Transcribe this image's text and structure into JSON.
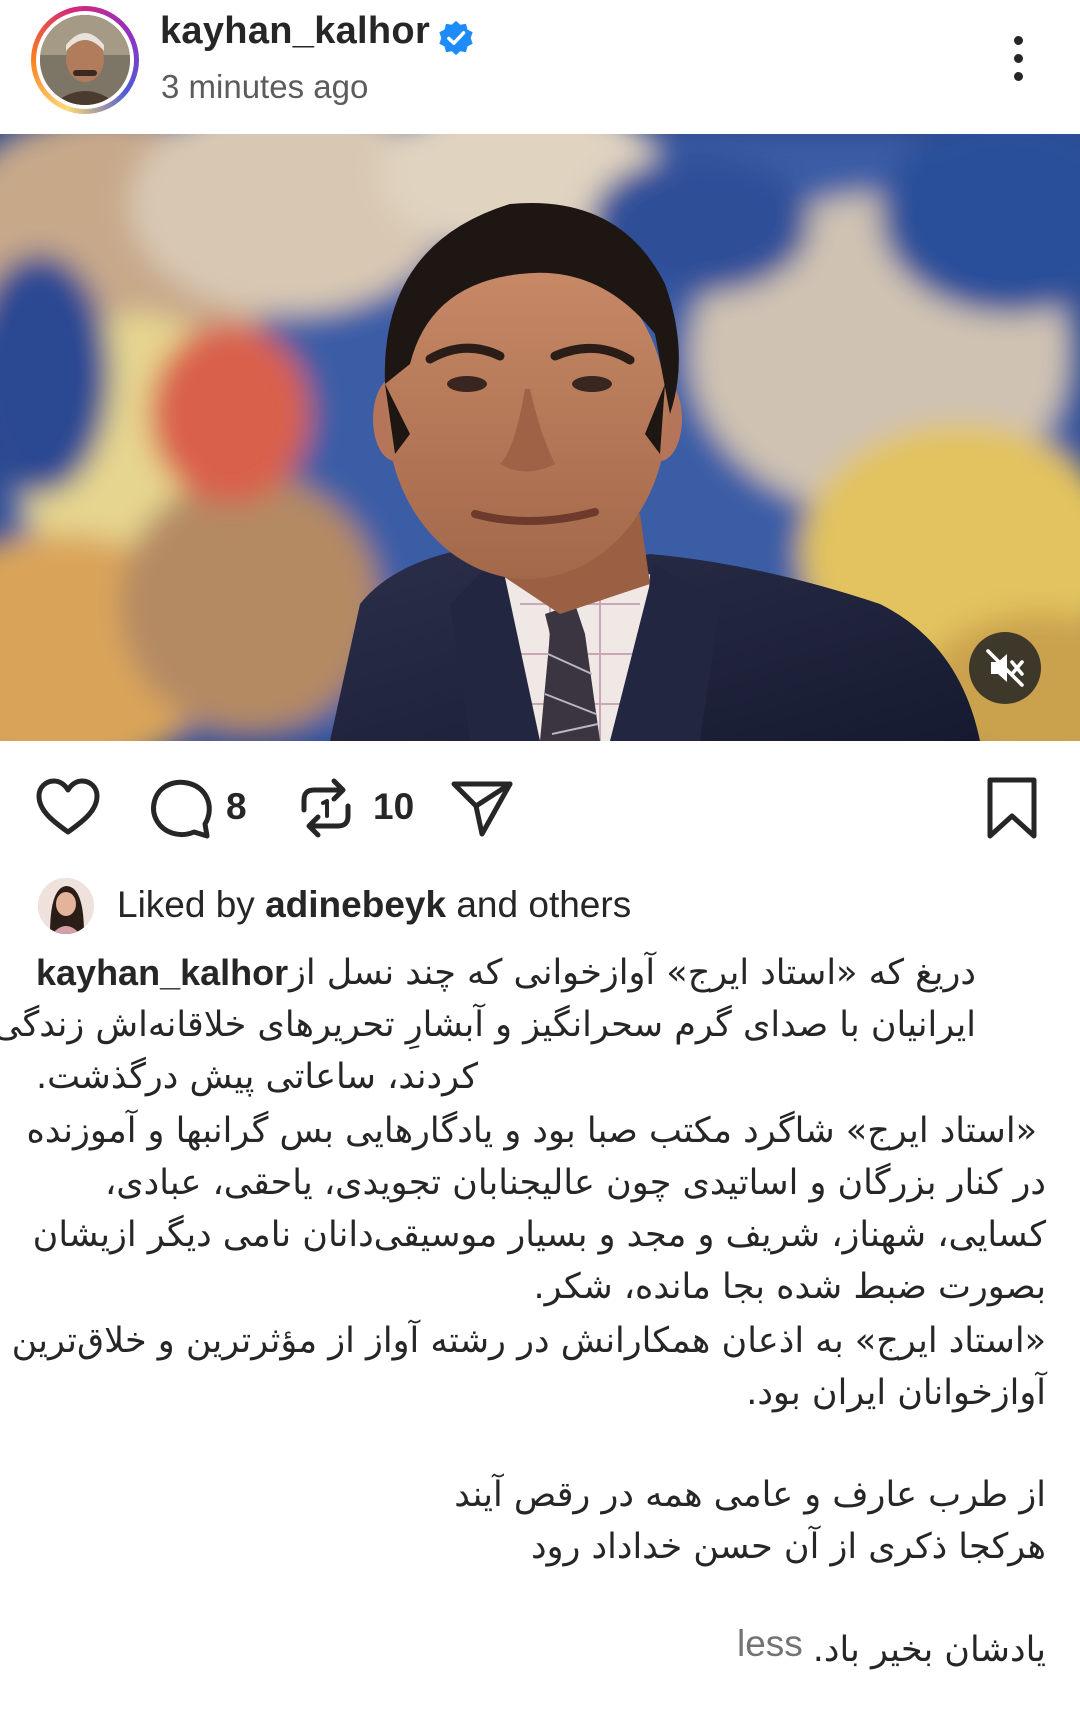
{
  "post": {
    "username": "kayhan_kalhor",
    "timestamp": "3 minutes ago",
    "verified": true,
    "avatar_icon": "user-avatar",
    "more_icon": "more-vertical-icon"
  },
  "media": {
    "mute_icon": "muted-speaker-icon"
  },
  "actions": {
    "like_icon": "heart-icon",
    "comment_icon": "comment-icon",
    "comment_count": "8",
    "repost_icon": "repost-icon",
    "repost_count": "10",
    "share_icon": "send-icon",
    "save_icon": "bookmark-icon"
  },
  "likes": {
    "prefix": "Liked by",
    "user": "adinebeyk",
    "suffix": "and others"
  },
  "caption": {
    "username": "kayhan_kalhor",
    "lines": [
      "دریغ که «استاد ایرج» آوازخوانی که چند نسل از",
      "ایرانیان با صدای گرم سحرانگیز و آبشارِ تحریرهای خلاقانه‌اش زندگی",
      "کردند، ساعاتی پیش درگذشت.",
      "«استاد ایرج» شاگرد مکتب صبا بود و یادگارهایی بس گرانبها و آموزنده",
      "در کنار بزرگان و اساتیدی چون عالیجنابان تجویدی، یاحقی، عبادی،",
      "کسایی، شهناز، شریف و مجد و بسیار موسیقی‌دانان نامی دیگر ازیشان",
      "بصورت ضبط شده بجا مانده، شکر.",
      "«استاد ایرج» به اذعان همکارانش در رشته آواز از مؤثرترین و خلاق‌ترین",
      "آوازخوانان ایران بود.",
      "از طرب عارف و عامی همه در رقص آیند",
      "هرکجا ذکری از آن حسن خداداد رود",
      "یادشان بخیر باد."
    ],
    "less_label": "less"
  }
}
